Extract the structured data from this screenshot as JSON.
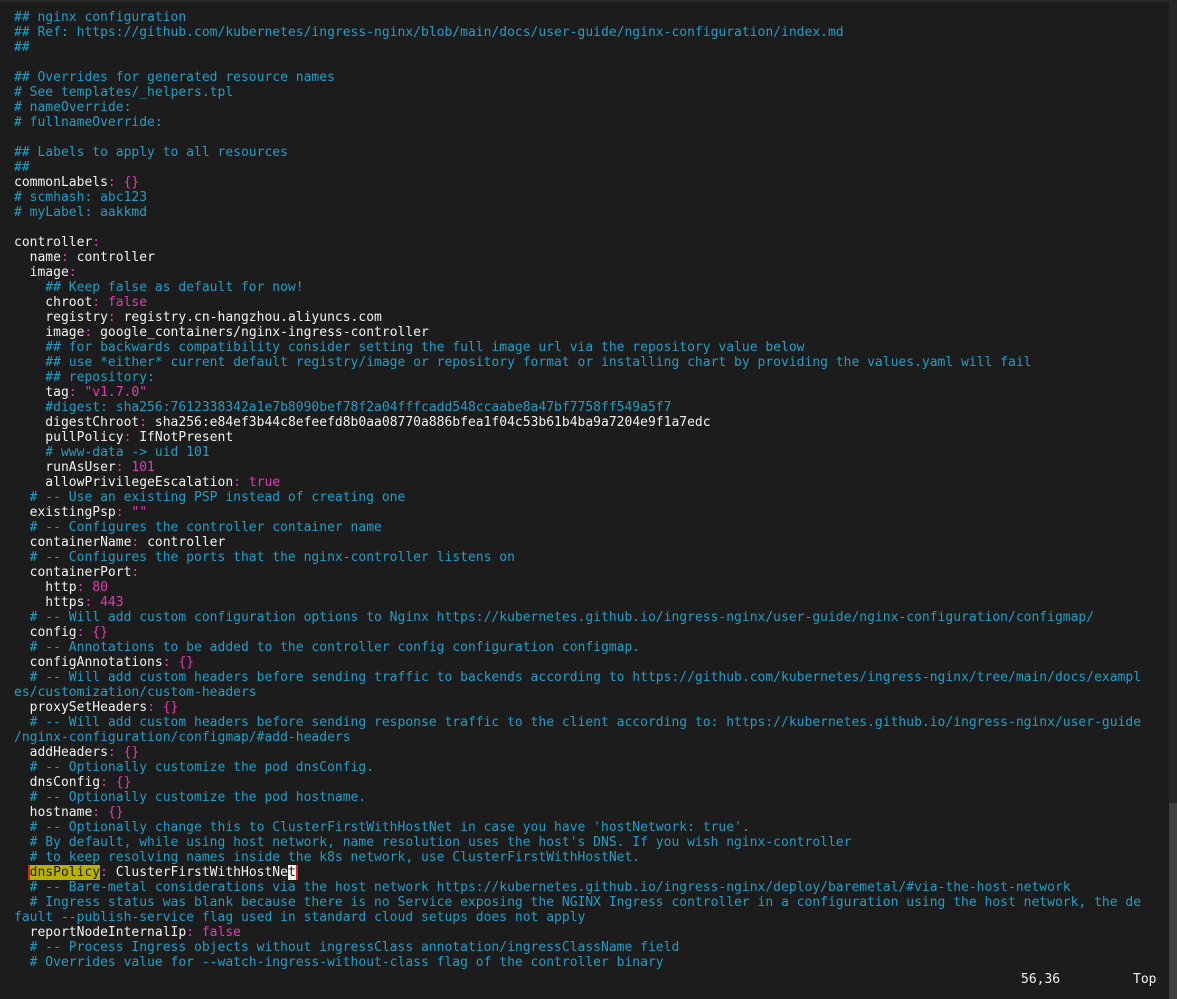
{
  "editor": {
    "lines": [
      [
        {
          "t": "## nginx configuration",
          "c": "c"
        }
      ],
      [
        {
          "t": "## Ref: https://github.com/kubernetes/ingress-nginx/blob/main/docs/user-guide/nginx-configuration/index.md",
          "c": "c"
        }
      ],
      [
        {
          "t": "##",
          "c": "c"
        }
      ],
      [],
      [
        {
          "t": "## Overrides for generated resource names",
          "c": "c"
        }
      ],
      [
        {
          "t": "# See templates/_helpers.tpl",
          "c": "c"
        }
      ],
      [
        {
          "t": "# nameOverride:",
          "c": "c"
        }
      ],
      [
        {
          "t": "# fullnameOverride:",
          "c": "c"
        }
      ],
      [],
      [
        {
          "t": "## Labels to apply to all resources",
          "c": "c"
        }
      ],
      [
        {
          "t": "##",
          "c": "c"
        }
      ],
      [
        {
          "t": "commonLabels",
          "c": "k"
        },
        {
          "t": ": ",
          "c": "p"
        },
        {
          "t": "{}",
          "c": "b"
        }
      ],
      [
        {
          "t": "# scmhash: abc123",
          "c": "c"
        }
      ],
      [
        {
          "t": "# myLabel: aakkmd",
          "c": "c"
        }
      ],
      [],
      [
        {
          "t": "controller",
          "c": "k"
        },
        {
          "t": ":",
          "c": "p"
        }
      ],
      [
        {
          "t": "  name",
          "c": "k"
        },
        {
          "t": ": ",
          "c": "p"
        },
        {
          "t": "controller",
          "c": "v"
        }
      ],
      [
        {
          "t": "  image",
          "c": "k"
        },
        {
          "t": ":",
          "c": "p"
        }
      ],
      [
        {
          "t": "    ## Keep false as default for now!",
          "c": "c"
        }
      ],
      [
        {
          "t": "    chroot",
          "c": "k"
        },
        {
          "t": ": ",
          "c": "p"
        },
        {
          "t": "false",
          "c": "n"
        }
      ],
      [
        {
          "t": "    registry",
          "c": "k"
        },
        {
          "t": ": ",
          "c": "p"
        },
        {
          "t": "registry.cn-hangzhou.aliyuncs.com",
          "c": "v"
        }
      ],
      [
        {
          "t": "    image",
          "c": "k"
        },
        {
          "t": ": ",
          "c": "p"
        },
        {
          "t": "google_containers/nginx-ingress-controller",
          "c": "v"
        }
      ],
      [
        {
          "t": "    ## for backwards compatibility consider setting the full image url via the repository value below",
          "c": "c"
        }
      ],
      [
        {
          "t": "    ## use *either* current default registry/image or repository format or installing chart by providing the values.yaml will fail",
          "c": "c"
        }
      ],
      [
        {
          "t": "    ## repository:",
          "c": "c"
        }
      ],
      [
        {
          "t": "    tag",
          "c": "k"
        },
        {
          "t": ": ",
          "c": "p"
        },
        {
          "t": "\"v1.7.0\"",
          "c": "s"
        }
      ],
      [
        {
          "t": "    #digest: sha256:7612338342a1e7b8090bef78f2a04fffcadd548ccaabe8a47bf7758ff549a5f7",
          "c": "c"
        }
      ],
      [
        {
          "t": "    digestChroot",
          "c": "k"
        },
        {
          "t": ": ",
          "c": "p"
        },
        {
          "t": "sha256:e84ef3b44c8efeefd8b0aa08770a886bfea1f04c53b61b4ba9a7204e9f1a7edc",
          "c": "v"
        }
      ],
      [
        {
          "t": "    pullPolicy",
          "c": "k"
        },
        {
          "t": ": ",
          "c": "p"
        },
        {
          "t": "IfNotPresent",
          "c": "v"
        }
      ],
      [
        {
          "t": "    # www-data -> uid 101",
          "c": "c"
        }
      ],
      [
        {
          "t": "    runAsUser",
          "c": "k"
        },
        {
          "t": ": ",
          "c": "p"
        },
        {
          "t": "101",
          "c": "n"
        }
      ],
      [
        {
          "t": "    allowPrivilegeEscalation",
          "c": "k"
        },
        {
          "t": ": ",
          "c": "p"
        },
        {
          "t": "true",
          "c": "n"
        }
      ],
      [
        {
          "t": "  # -- Use an existing PSP instead of creating one",
          "c": "c"
        }
      ],
      [
        {
          "t": "  existingPsp",
          "c": "k"
        },
        {
          "t": ": ",
          "c": "p"
        },
        {
          "t": "\"\"",
          "c": "s"
        }
      ],
      [
        {
          "t": "  # -- Configures the controller container name",
          "c": "c"
        }
      ],
      [
        {
          "t": "  containerName",
          "c": "k"
        },
        {
          "t": ": ",
          "c": "p"
        },
        {
          "t": "controller",
          "c": "v"
        }
      ],
      [
        {
          "t": "  # -- Configures the ports that the nginx-controller listens on",
          "c": "c"
        }
      ],
      [
        {
          "t": "  containerPort",
          "c": "k"
        },
        {
          "t": ":",
          "c": "p"
        }
      ],
      [
        {
          "t": "    http",
          "c": "k"
        },
        {
          "t": ": ",
          "c": "p"
        },
        {
          "t": "80",
          "c": "n"
        }
      ],
      [
        {
          "t": "    https",
          "c": "k"
        },
        {
          "t": ": ",
          "c": "p"
        },
        {
          "t": "443",
          "c": "n"
        }
      ],
      [
        {
          "t": "  # -- Will add custom configuration options to Nginx https://kubernetes.github.io/ingress-nginx/user-guide/nginx-configuration/configmap/",
          "c": "c"
        }
      ],
      [
        {
          "t": "  config",
          "c": "k"
        },
        {
          "t": ": ",
          "c": "p"
        },
        {
          "t": "{}",
          "c": "b"
        }
      ],
      [
        {
          "t": "  # -- Annotations to be added to the controller config configuration configmap.",
          "c": "c"
        }
      ],
      [
        {
          "t": "  configAnnotations",
          "c": "k"
        },
        {
          "t": ": ",
          "c": "p"
        },
        {
          "t": "{}",
          "c": "b"
        }
      ],
      [
        {
          "t": "  # -- Will add custom headers before sending traffic to backends according to https://github.com/kubernetes/ingress-nginx/tree/main/docs/exampl",
          "c": "c"
        }
      ],
      [
        {
          "t": "es/customization/custom-headers",
          "c": "c"
        }
      ],
      [
        {
          "t": "  proxySetHeaders",
          "c": "k"
        },
        {
          "t": ": ",
          "c": "p"
        },
        {
          "t": "{}",
          "c": "b"
        }
      ],
      [
        {
          "t": "  # -- Will add custom headers before sending response traffic to the client according to: https://kubernetes.github.io/ingress-nginx/user-guide",
          "c": "c"
        }
      ],
      [
        {
          "t": "/nginx-configuration/configmap/#add-headers",
          "c": "c"
        }
      ],
      [
        {
          "t": "  addHeaders",
          "c": "k"
        },
        {
          "t": ": ",
          "c": "p"
        },
        {
          "t": "{}",
          "c": "b"
        }
      ],
      [
        {
          "t": "  # -- Optionally customize the pod dnsConfig.",
          "c": "c"
        }
      ],
      [
        {
          "t": "  dnsConfig",
          "c": "k"
        },
        {
          "t": ": ",
          "c": "p"
        },
        {
          "t": "{}",
          "c": "b"
        }
      ],
      [
        {
          "t": "  # -- Optionally customize the pod hostname.",
          "c": "c"
        }
      ],
      [
        {
          "t": "  hostname",
          "c": "k"
        },
        {
          "t": ": ",
          "c": "p"
        },
        {
          "t": "{}",
          "c": "b"
        }
      ],
      [
        {
          "t": "  # -- Optionally change this to ClusterFirstWithHostNet in case you have 'hostNetwork: true'.",
          "c": "c"
        }
      ],
      [
        {
          "t": "  # By default, while using host network, name resolution uses the host's DNS. If you wish nginx-controller",
          "c": "c"
        }
      ],
      [
        {
          "t": "  # to keep resolving names inside the k8s network, use ClusterFirstWithHostNet.",
          "c": "c"
        }
      ],
      [
        {
          "t": "  ",
          "c": "k"
        },
        {
          "t": "dnsPolicy",
          "c": "hl",
          "box": "start"
        },
        {
          "t": ": ",
          "c": "p",
          "box": "mid"
        },
        {
          "t": "ClusterFirstWithHostNe",
          "c": "v",
          "box": "mid"
        },
        {
          "t": "t",
          "c": "cur",
          "box": "end"
        }
      ],
      [
        {
          "t": "  # -- Bare-metal considerations via the host network https://kubernetes.github.io/ingress-nginx/deploy/baremetal/#via-the-host-network",
          "c": "c"
        }
      ],
      [
        {
          "t": "  # Ingress status was blank because there is no Service exposing the NGINX Ingress controller in a configuration using the host network, the de",
          "c": "c"
        }
      ],
      [
        {
          "t": "fault --publish-service flag used in standard cloud setups does not apply",
          "c": "c"
        }
      ],
      [
        {
          "t": "  reportNodeInternalIp",
          "c": "k"
        },
        {
          "t": ": ",
          "c": "p"
        },
        {
          "t": "false",
          "c": "n"
        }
      ],
      [
        {
          "t": "  # -- Process Ingress objects without ingressClass annotation/ingressClassName field",
          "c": "c"
        }
      ],
      [
        {
          "t": "  # Overrides value for --watch-ingress-without-class flag of the controller binary",
          "c": "c"
        }
      ]
    ]
  },
  "status": {
    "cursor_position": "56,36",
    "scroll_position": "Top"
  },
  "colors": {
    "background": "#1c1c1c",
    "comment": "#1f9fc7",
    "key": "#f2f2f2",
    "punct_value": "#e23ab8",
    "search_highlight": "#b9b300",
    "annotation_box": "#e02020"
  }
}
